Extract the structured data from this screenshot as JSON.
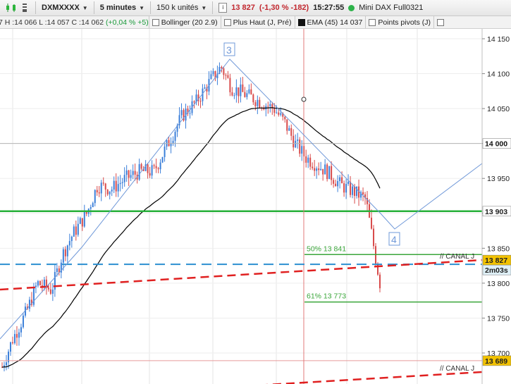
{
  "toolbar": {
    "symbol": "DXMXXXX",
    "timeframe": "5 minutes",
    "units": "150 k unités",
    "last_price": "13 827",
    "change": "(-1,30 % -182)",
    "time": "15:27:55",
    "instrument": "Mini DAX Full0321"
  },
  "indicators_bar": {
    "ohlc_prefix": "7 H :14 066 L :14 057 C :14 062",
    "ohlc_change": "(+0,04 % +5)",
    "items": [
      {
        "label": "Bollinger (20 2.9)",
        "checked": false
      },
      {
        "label": "Plus Haut (J, Pré)",
        "checked": false
      },
      {
        "label": "EMA (45)  14 037",
        "checked": true
      },
      {
        "label": "Points pivots (J)",
        "checked": false
      },
      {
        "label": "",
        "checked": false
      }
    ]
  },
  "colors": {
    "candle_up": "#3b7fd9",
    "candle_down": "#d84a4a",
    "ema": "#000000",
    "support_green": "#27b03a",
    "fib_green": "#3aa63a",
    "trendline_blue": "#6f98d8",
    "canal_red": "#e02020",
    "dashed_blue": "#2b8fd0"
  },
  "chart_data": {
    "type": "candlestick",
    "instrument": "Mini DAX Full0321",
    "timeframe": "5 minutes",
    "y_ticks": [
      13700,
      13750,
      13800,
      13850,
      13900,
      13950,
      14000,
      14050,
      14100,
      14150
    ],
    "y_tick_labels": [
      "13 700",
      "13 750",
      "13 800",
      "13 850",
      "13 900",
      "13 950",
      "14 000",
      "14 050",
      "14 100",
      "14 150"
    ],
    "ylim": [
      13640,
      14170
    ],
    "n_bars": 180,
    "candles_close_path": [
      [
        0,
        13680
      ],
      [
        6,
        13720
      ],
      [
        14,
        13760
      ],
      [
        20,
        13800
      ],
      [
        28,
        13790
      ],
      [
        34,
        13840
      ],
      [
        40,
        13870
      ],
      [
        48,
        13900
      ],
      [
        54,
        13940
      ],
      [
        62,
        13935
      ],
      [
        70,
        13950
      ],
      [
        78,
        13960
      ],
      [
        86,
        13960
      ],
      [
        94,
        14000
      ],
      [
        102,
        14040
      ],
      [
        110,
        14060
      ],
      [
        118,
        14090
      ],
      [
        124,
        14110
      ],
      [
        130,
        14080
      ],
      [
        138,
        14070
      ],
      [
        146,
        14060
      ],
      [
        154,
        14050
      ],
      [
        160,
        14030
      ],
      [
        166,
        14000
      ],
      [
        172,
        13980
      ],
      [
        178,
        13970
      ],
      [
        184,
        13960
      ],
      [
        192,
        13940
      ],
      [
        200,
        13930
      ],
      [
        206,
        13920
      ],
      [
        212,
        13830
      ],
      [
        214,
        13800
      ]
    ],
    "ema_label": "EMA (45)",
    "ema_value": 14037,
    "levels": [
      {
        "name": "support",
        "value": 13903,
        "label": "13 903",
        "color": "#27b03a"
      },
      {
        "name": "fib-50",
        "value": 13841,
        "label": "50% 13 841",
        "color": "#3aa63a"
      },
      {
        "name": "fib-61",
        "value": 13773,
        "label": "61% 13 773",
        "color": "#3aa63a"
      },
      {
        "name": "last-price",
        "value": 13827,
        "label": "13 827"
      },
      {
        "name": "plus-haut",
        "value": 14000,
        "label": "14 000"
      },
      {
        "name": "plus-bas",
        "value": 13689,
        "label": "13 689"
      }
    ],
    "countdown": "2m03s",
    "dashed_level_label": "13 827",
    "canal_labels": [
      "// CANAL J",
      "// CANAL J"
    ],
    "wave_labels": [
      "3",
      "4"
    ],
    "grid": true
  }
}
